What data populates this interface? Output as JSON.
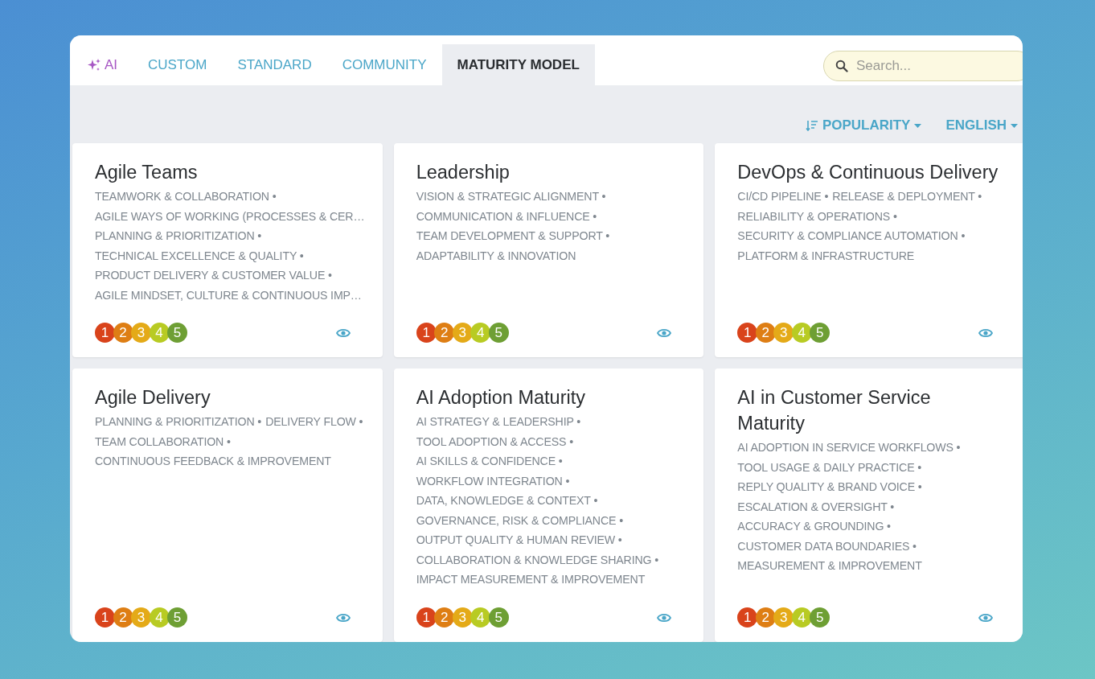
{
  "tabs": [
    {
      "label": "AI",
      "kind": "ai",
      "selected": false
    },
    {
      "label": "CUSTOM",
      "kind": "plain",
      "selected": false
    },
    {
      "label": "STANDARD",
      "kind": "plain",
      "selected": false
    },
    {
      "label": "COMMUNITY",
      "kind": "plain",
      "selected": false
    },
    {
      "label": "MATURITY MODEL",
      "kind": "plain",
      "selected": true
    }
  ],
  "search": {
    "placeholder": "Search..."
  },
  "toolbar": {
    "sort": "POPULARITY",
    "language": "ENGLISH"
  },
  "cards": [
    {
      "title": "Agile Teams",
      "tags": [
        "TEAMWORK & COLLABORATION •",
        "AGILE WAYS OF WORKING (PROCESSES & CER…",
        "PLANNING & PRIORITIZATION •",
        "TECHNICAL EXCELLENCE & QUALITY •",
        "PRODUCT DELIVERY & CUSTOMER VALUE •",
        "AGILE MINDSET, CULTURE & CONTINUOUS IMP…"
      ],
      "levels": [
        {
          "label": "1",
          "color": "#d9431b"
        },
        {
          "label": "2",
          "color": "#de7e14"
        },
        {
          "label": "3",
          "color": "#e4aa18"
        },
        {
          "label": "4",
          "color": "#b8cb23"
        },
        {
          "label": "5",
          "color": "#6e9f34"
        }
      ]
    },
    {
      "title": "Leadership",
      "tags": [
        "VISION & STRATEGIC ALIGNMENT •",
        "COMMUNICATION & INFLUENCE •",
        "TEAM DEVELOPMENT & SUPPORT •",
        "ADAPTABILITY & INNOVATION"
      ],
      "levels": [
        {
          "label": "1",
          "color": "#d9431b"
        },
        {
          "label": "2",
          "color": "#de7e14"
        },
        {
          "label": "3",
          "color": "#e4aa18"
        },
        {
          "label": "4",
          "color": "#b8cb23"
        },
        {
          "label": "5",
          "color": "#6e9f34"
        }
      ]
    },
    {
      "title": "DevOps & Continuous Delivery",
      "tags": [
        "CI/CD PIPELINE •",
        "RELEASE & DEPLOYMENT •",
        "RELIABILITY & OPERATIONS •",
        "SECURITY & COMPLIANCE AUTOMATION •",
        "PLATFORM & INFRASTRUCTURE"
      ],
      "levels": [
        {
          "label": "1",
          "color": "#d9431b"
        },
        {
          "label": "2",
          "color": "#de7e14"
        },
        {
          "label": "3",
          "color": "#e4aa18"
        },
        {
          "label": "4",
          "color": "#b8cb23"
        },
        {
          "label": "5",
          "color": "#6e9f34"
        }
      ]
    },
    {
      "title": "Agile Delivery",
      "tags": [
        "PLANNING & PRIORITIZATION •",
        "DELIVERY FLOW •",
        "TEAM COLLABORATION •",
        "CONTINUOUS FEEDBACK & IMPROVEMENT"
      ],
      "levels": [
        {
          "label": "1",
          "color": "#d9431b"
        },
        {
          "label": "2",
          "color": "#de7e14"
        },
        {
          "label": "3",
          "color": "#e4aa18"
        },
        {
          "label": "4",
          "color": "#b8cb23"
        },
        {
          "label": "5",
          "color": "#6e9f34"
        }
      ]
    },
    {
      "title": "AI Adoption Maturity",
      "tags": [
        "AI STRATEGY & LEADERSHIP •",
        "TOOL ADOPTION & ACCESS •",
        "AI SKILLS & CONFIDENCE •",
        "WORKFLOW INTEGRATION •",
        "DATA, KNOWLEDGE & CONTEXT •",
        "GOVERNANCE, RISK & COMPLIANCE •",
        "OUTPUT QUALITY & HUMAN REVIEW •",
        "COLLABORATION & KNOWLEDGE SHARING •",
        "IMPACT MEASUREMENT & IMPROVEMENT"
      ],
      "levels": [
        {
          "label": "1",
          "color": "#d9431b"
        },
        {
          "label": "2",
          "color": "#de7e14"
        },
        {
          "label": "3",
          "color": "#e4aa18"
        },
        {
          "label": "4",
          "color": "#b8cb23"
        },
        {
          "label": "5",
          "color": "#6e9f34"
        }
      ]
    },
    {
      "title": "AI in Customer Service Maturity",
      "tags": [
        "AI ADOPTION IN SERVICE WORKFLOWS •",
        "TOOL USAGE & DAILY PRACTICE •",
        "REPLY QUALITY & BRAND VOICE •",
        "ESCALATION & OVERSIGHT •",
        "ACCURACY & GROUNDING •",
        "CUSTOMER DATA BOUNDARIES •",
        "MEASUREMENT & IMPROVEMENT"
      ],
      "levels": [
        {
          "label": "1",
          "color": "#d9431b"
        },
        {
          "label": "2",
          "color": "#de7e14"
        },
        {
          "label": "3",
          "color": "#e4aa18"
        },
        {
          "label": "4",
          "color": "#b8cb23"
        },
        {
          "label": "5",
          "color": "#6e9f34"
        }
      ]
    }
  ]
}
